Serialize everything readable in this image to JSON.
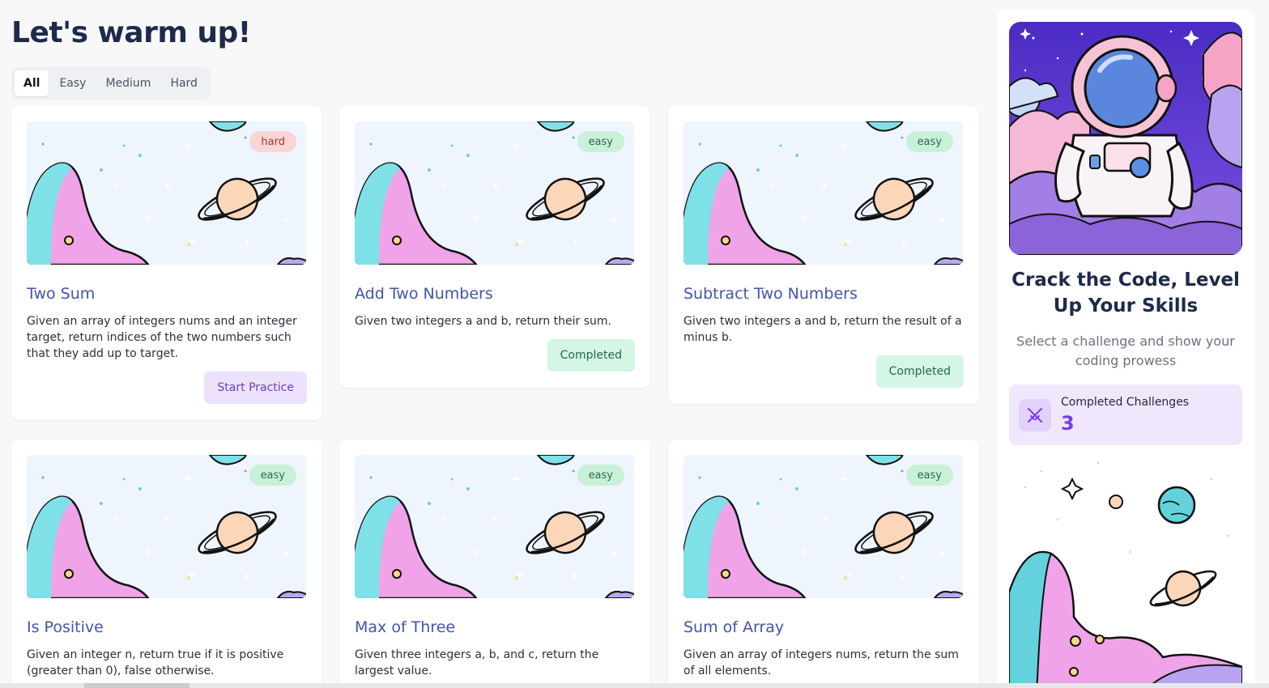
{
  "page": {
    "title": "Let's warm up!"
  },
  "filters": {
    "tabs": [
      "All",
      "Easy",
      "Medium",
      "Hard"
    ],
    "active": "All"
  },
  "challenges": [
    {
      "title": "Two Sum",
      "description": "Given an array of integers nums and an integer target, return indices of the two numbers such that they add up to target.",
      "difficulty": "hard",
      "action": "Start Practice"
    },
    {
      "title": "Add Two Numbers",
      "description": "Given two integers a and b, return their sum.",
      "difficulty": "easy",
      "action": "Completed"
    },
    {
      "title": "Subtract Two Numbers",
      "description": "Given two integers a and b, return the result of a minus b.",
      "difficulty": "easy",
      "action": "Completed"
    },
    {
      "title": "Is Positive",
      "description": "Given an integer n, return true if it is positive (greater than 0), false otherwise.",
      "difficulty": "easy"
    },
    {
      "title": "Max of Three",
      "description": "Given three integers a, b, and c, return the largest value.",
      "difficulty": "easy"
    },
    {
      "title": "Sum of Array",
      "description": "Given an array of integers nums, return the sum of all elements.",
      "difficulty": "easy"
    }
  ],
  "sidebar": {
    "title": "Crack the Code, Level Up Your Skills",
    "subtitle": "Select a challenge and show your coding prowess",
    "stats": {
      "label": "Completed Challenges",
      "value": "3"
    },
    "hero_icon": "astronaut-illustration"
  },
  "colors": {
    "accent": "#7c3aed",
    "title": "#4255a8",
    "easy_badge": "#c9f1d8",
    "hard_badge": "#fbd5d5",
    "completed": "#d4f6e3",
    "start": "#ede2fd"
  }
}
